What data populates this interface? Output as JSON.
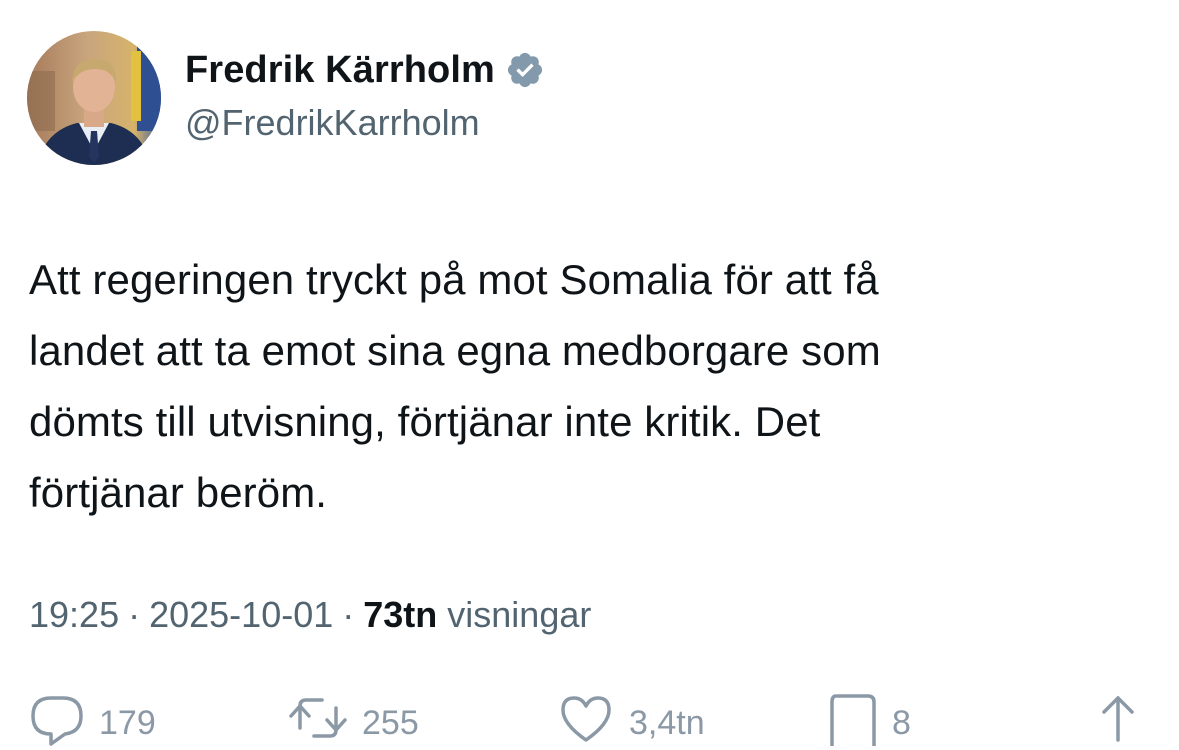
{
  "author": {
    "display_name": "Fredrik Kärrholm",
    "handle": "@FredrikKarrholm",
    "verified": true,
    "verified_color": "#829aab"
  },
  "tweet": {
    "text": "Att regeringen tryckt på mot Somalia för att få\nlandet att ta emot sina egna medborgare som\ndömts till utvisning, förtjänar inte kritik. Det\nförtjänar beröm."
  },
  "meta": {
    "time": "19:25",
    "separator": "·",
    "date": "2025-10-01",
    "views_count": "73tn",
    "views_label": "visningar"
  },
  "actions": {
    "replies": "179",
    "reposts": "255",
    "likes": "3,4tn",
    "bookmarks": "8",
    "icons": [
      "reply-icon",
      "repost-icon",
      "like-icon",
      "bookmark-icon",
      "share-icon"
    ]
  },
  "colors": {
    "text_primary": "#0f1419",
    "text_secondary": "#536471",
    "icon_gray": "#8b98a5"
  }
}
